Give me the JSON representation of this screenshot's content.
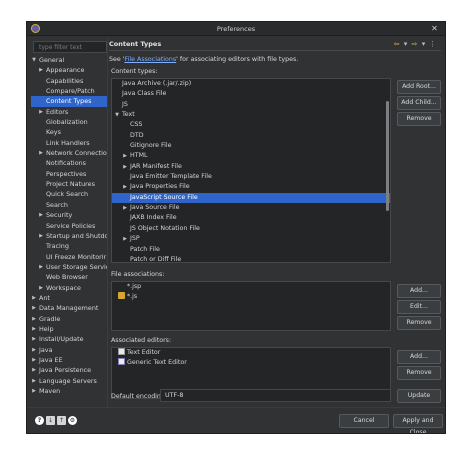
{
  "window": {
    "title": "Preferences"
  },
  "filter": {
    "placeholder": "type filter text"
  },
  "tree": [
    {
      "label": "General",
      "indent": 0,
      "state": "open"
    },
    {
      "label": "Appearance",
      "indent": 1,
      "state": "closed"
    },
    {
      "label": "Capabilities",
      "indent": 1,
      "state": "leaf"
    },
    {
      "label": "Compare/Patch",
      "indent": 1,
      "state": "leaf"
    },
    {
      "label": "Content Types",
      "indent": 1,
      "state": "leaf",
      "selected": true
    },
    {
      "label": "Editors",
      "indent": 1,
      "state": "closed"
    },
    {
      "label": "Globalization",
      "indent": 1,
      "state": "leaf"
    },
    {
      "label": "Keys",
      "indent": 1,
      "state": "leaf"
    },
    {
      "label": "Link Handlers",
      "indent": 1,
      "state": "leaf"
    },
    {
      "label": "Network Connectio",
      "indent": 1,
      "state": "closed"
    },
    {
      "label": "Notifications",
      "indent": 1,
      "state": "leaf"
    },
    {
      "label": "Perspectives",
      "indent": 1,
      "state": "leaf"
    },
    {
      "label": "Project Natures",
      "indent": 1,
      "state": "leaf"
    },
    {
      "label": "Quick Search",
      "indent": 1,
      "state": "leaf"
    },
    {
      "label": "Search",
      "indent": 1,
      "state": "leaf"
    },
    {
      "label": "Security",
      "indent": 1,
      "state": "closed"
    },
    {
      "label": "Service Policies",
      "indent": 1,
      "state": "leaf"
    },
    {
      "label": "Startup and Shutdo",
      "indent": 1,
      "state": "closed"
    },
    {
      "label": "Tracing",
      "indent": 1,
      "state": "leaf"
    },
    {
      "label": "UI Freeze Monitorir",
      "indent": 1,
      "state": "leaf"
    },
    {
      "label": "User Storage Servic",
      "indent": 1,
      "state": "closed"
    },
    {
      "label": "Web Browser",
      "indent": 1,
      "state": "leaf"
    },
    {
      "label": "Workspace",
      "indent": 1,
      "state": "closed"
    },
    {
      "label": "Ant",
      "indent": 0,
      "state": "closed"
    },
    {
      "label": "Data Management",
      "indent": 0,
      "state": "closed"
    },
    {
      "label": "Gradle",
      "indent": 0,
      "state": "closed"
    },
    {
      "label": "Help",
      "indent": 0,
      "state": "closed"
    },
    {
      "label": "Install/Update",
      "indent": 0,
      "state": "closed"
    },
    {
      "label": "Java",
      "indent": 0,
      "state": "closed"
    },
    {
      "label": "Java EE",
      "indent": 0,
      "state": "closed"
    },
    {
      "label": "Java Persistence",
      "indent": 0,
      "state": "closed"
    },
    {
      "label": "Language Servers",
      "indent": 0,
      "state": "closed"
    },
    {
      "label": "Maven",
      "indent": 0,
      "state": "closed"
    }
  ],
  "pane": {
    "title": "Content Types",
    "desc_pre": "See '",
    "desc_link": "File Associations",
    "desc_post": "' for associating editors with file types."
  },
  "content_types": {
    "label": "Content types:",
    "items": [
      {
        "label": "Java Archive (.jar/.zip)",
        "indent": 0,
        "state": "leaf"
      },
      {
        "label": "Java Class File",
        "indent": 0,
        "state": "leaf"
      },
      {
        "label": "JS",
        "indent": 0,
        "state": "leaf"
      },
      {
        "label": "Text",
        "indent": 0,
        "state": "open"
      },
      {
        "label": "CSS",
        "indent": 1,
        "state": "leaf"
      },
      {
        "label": "DTD",
        "indent": 1,
        "state": "leaf"
      },
      {
        "label": "Gitignore File",
        "indent": 1,
        "state": "leaf"
      },
      {
        "label": "HTML",
        "indent": 1,
        "state": "closed"
      },
      {
        "label": "JAR Manifest File",
        "indent": 1,
        "state": "closed"
      },
      {
        "label": "Java Emitter Template File",
        "indent": 1,
        "state": "leaf"
      },
      {
        "label": "Java Properties File",
        "indent": 1,
        "state": "closed"
      },
      {
        "label": "JavaScript Source File",
        "indent": 1,
        "state": "leaf",
        "selected": true
      },
      {
        "label": "Java Source File",
        "indent": 1,
        "state": "closed"
      },
      {
        "label": "JAXB Index File",
        "indent": 1,
        "state": "leaf"
      },
      {
        "label": "JS Object Notation File",
        "indent": 1,
        "state": "leaf"
      },
      {
        "label": "JSP",
        "indent": 1,
        "state": "closed"
      },
      {
        "label": "Patch File",
        "indent": 1,
        "state": "leaf"
      },
      {
        "label": "Patch or Diff File",
        "indent": 1,
        "state": "leaf"
      }
    ],
    "buttons": {
      "add_root": "Add Root...",
      "add_child": "Add Child...",
      "remove": "Remove"
    }
  },
  "file_assoc": {
    "label": "File associations:",
    "items": [
      {
        "label": "*.jsp",
        "locked": false
      },
      {
        "label": "*.js",
        "locked": true
      }
    ],
    "buttons": {
      "add": "Add...",
      "edit": "Edit...",
      "remove": "Remove"
    }
  },
  "editors": {
    "label": "Associated editors:",
    "items": [
      {
        "label": "Text Editor",
        "icon": "text-editor-icon"
      },
      {
        "label": "Generic Text Editor",
        "icon": "generic-text-editor-icon"
      }
    ],
    "buttons": {
      "add": "Add...",
      "remove": "Remove"
    }
  },
  "encoding": {
    "label": "Default encoding:",
    "value": "UTF-8",
    "update": "Update"
  },
  "footer": {
    "cancel": "Cancel",
    "apply_close": "Apply and Close"
  },
  "colors": {
    "selection": "#2f65ca",
    "background": "#303234",
    "field": "#242527"
  }
}
